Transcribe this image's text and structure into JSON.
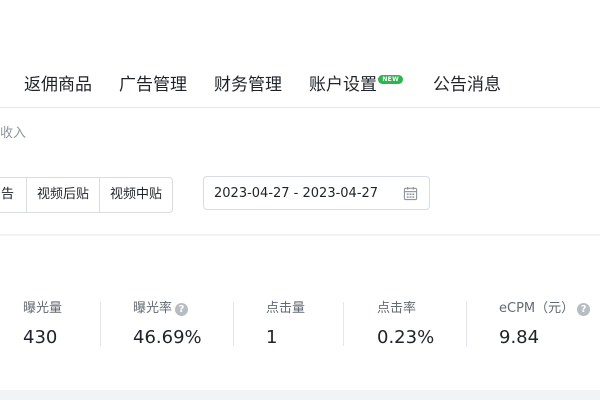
{
  "nav": {
    "items": [
      {
        "label": "返佣商品"
      },
      {
        "label": "广告管理"
      },
      {
        "label": "财务管理"
      },
      {
        "label": "账户设置",
        "badge": "NEW"
      },
      {
        "label": "公告消息"
      }
    ]
  },
  "filter": {
    "sub_label": "收入",
    "segments": [
      "告",
      "视频后贴",
      "视频中贴"
    ],
    "date_range": "2023-04-27 - 2023-04-27"
  },
  "stats": [
    {
      "label": "曝光量",
      "value": "430",
      "help": false
    },
    {
      "label": "曝光率",
      "value": "46.69%",
      "help": true
    },
    {
      "label": "点击量",
      "value": "1",
      "help": false
    },
    {
      "label": "点击率",
      "value": "0.23%",
      "help": false
    },
    {
      "label": "eCPM（元）",
      "value": "9.84",
      "help": true
    }
  ],
  "colors": {
    "badge": "#2fb54f",
    "background": "#f2f3f5"
  }
}
